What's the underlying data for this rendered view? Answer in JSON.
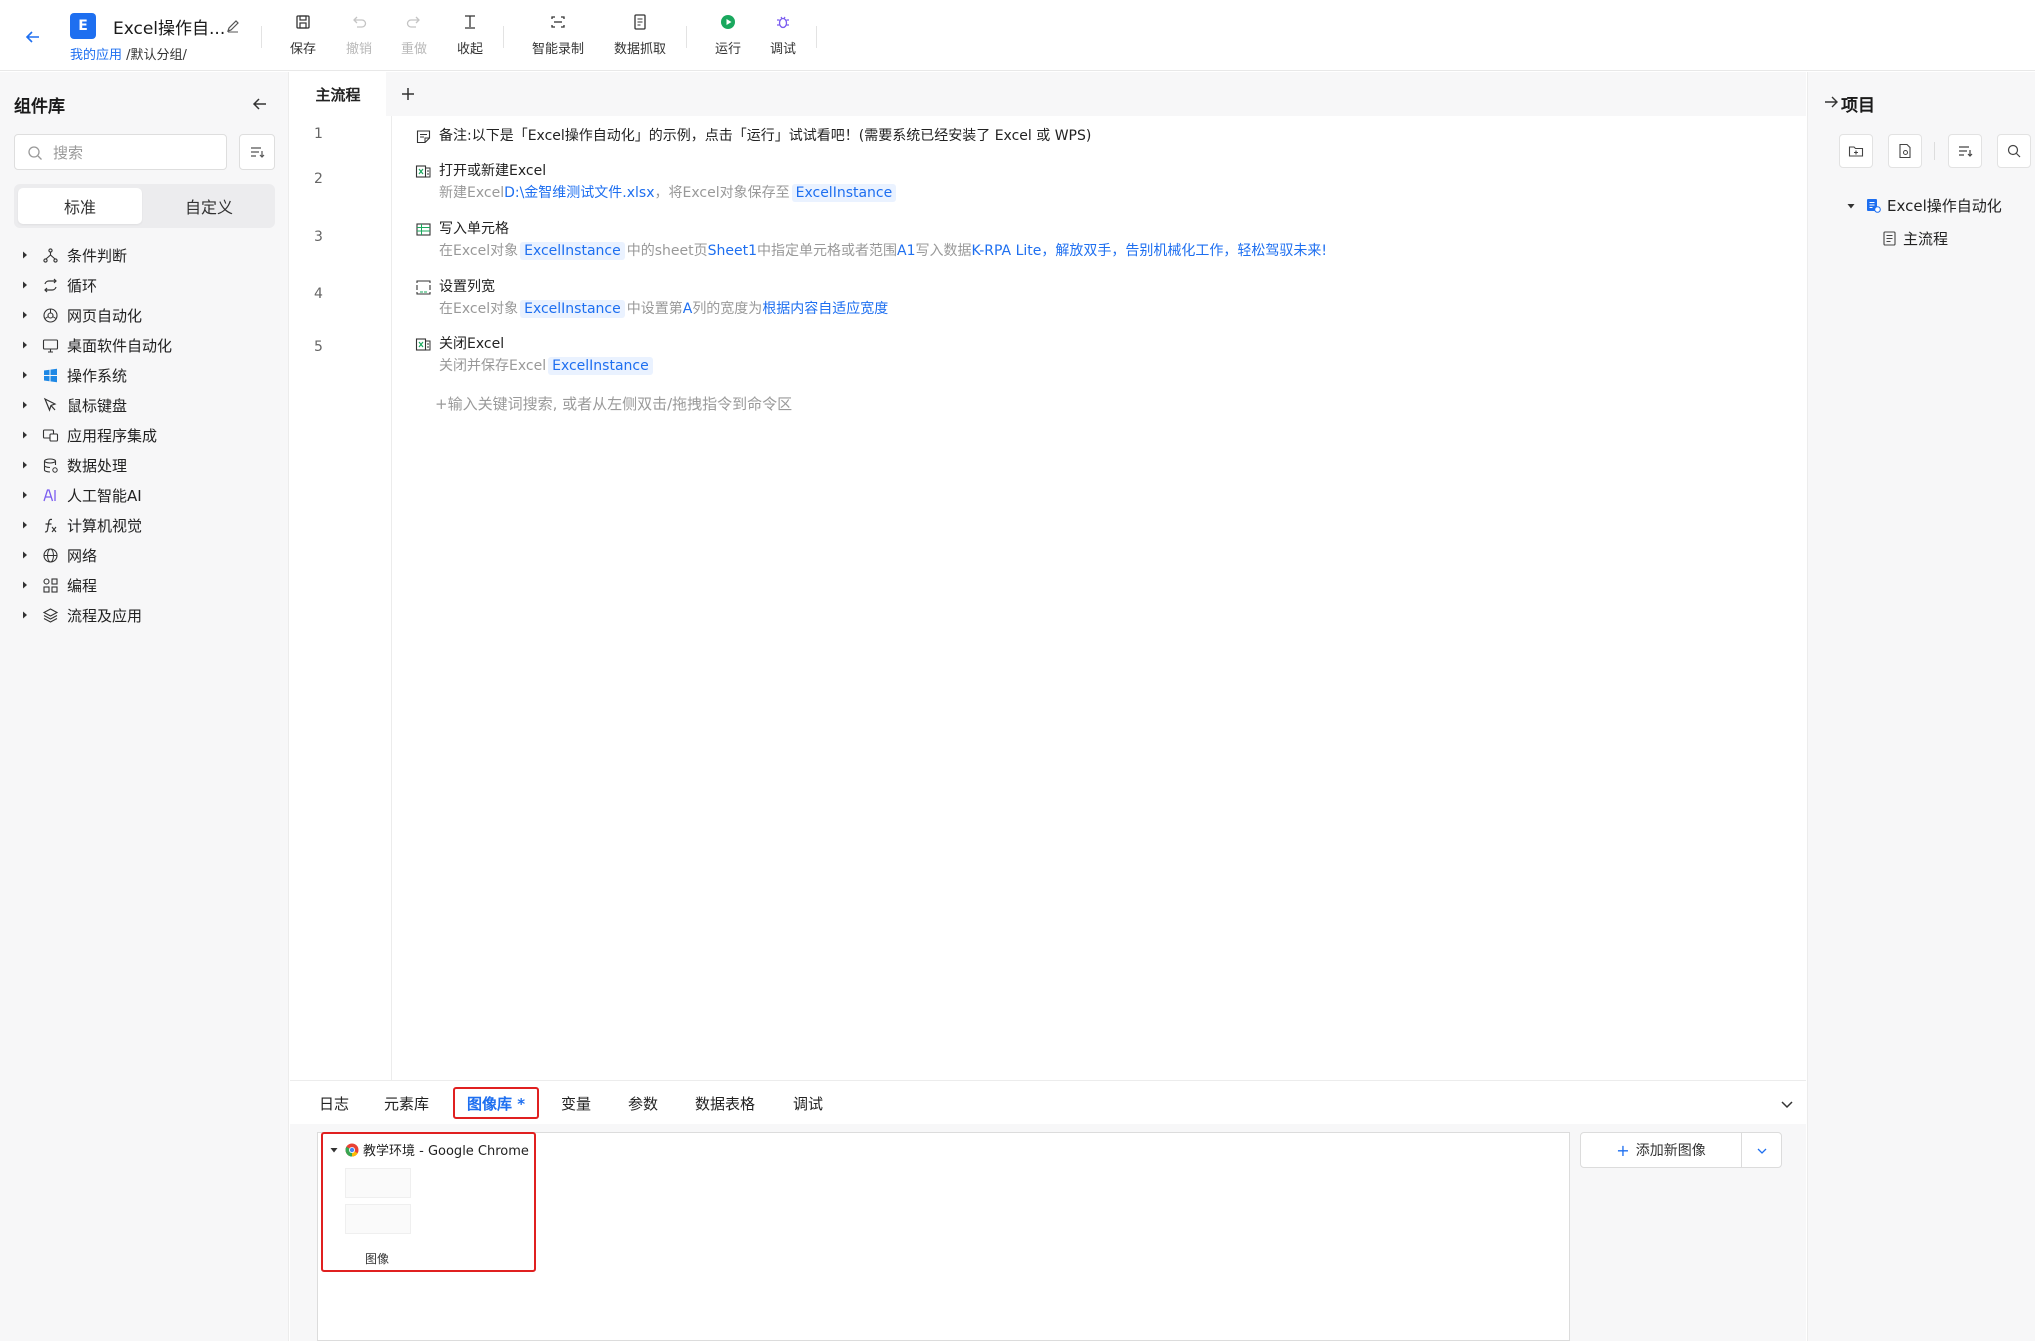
{
  "header": {
    "app_badge": "E",
    "app_title": "Excel操作自...",
    "breadcrumb_link": "我的应用",
    "breadcrumb_rest": "/默认分组/"
  },
  "toolbar": {
    "save": "保存",
    "undo": "撤销",
    "redo": "重做",
    "collapse": "收起",
    "smart_record": "智能录制",
    "data_capture": "数据抓取",
    "run": "运行",
    "debug": "调试"
  },
  "sidebar": {
    "title": "组件库",
    "search_placeholder": "搜索",
    "tab_standard": "标准",
    "tab_custom": "自定义",
    "categories": [
      {
        "label": "条件判断",
        "icon": "branch-icon"
      },
      {
        "label": "循环",
        "icon": "loop-icon"
      },
      {
        "label": "网页自动化",
        "icon": "browser-icon"
      },
      {
        "label": "桌面软件自动化",
        "icon": "desktop-icon"
      },
      {
        "label": "操作系统",
        "icon": "windows-icon"
      },
      {
        "label": "鼠标键盘",
        "icon": "cursor-icon"
      },
      {
        "label": "应用程序集成",
        "icon": "app-integration-icon"
      },
      {
        "label": "数据处理",
        "icon": "database-icon"
      },
      {
        "label": "人工智能AI",
        "icon": "ai-icon"
      },
      {
        "label": "计算机视觉",
        "icon": "function-icon"
      },
      {
        "label": "网络",
        "icon": "globe-icon"
      },
      {
        "label": "编程",
        "icon": "code-blocks-icon"
      },
      {
        "label": "流程及应用",
        "icon": "layers-icon"
      }
    ]
  },
  "editor": {
    "tab_main": "主流程",
    "line_numbers": [
      "1",
      "2",
      "3",
      "4",
      "5"
    ],
    "note": "备注:以下是「Excel操作自动化」的示例，点击「运行」试试看吧！(需要系统已经安装了 Excel 或 WPS)",
    "steps": {
      "s2": {
        "title": "打开或新建Excel",
        "d1": "新建Excel",
        "d2": "D:\\金智维测试文件.xlsx",
        "d3": "，将Excel对象保存至",
        "var": "ExcelInstance"
      },
      "s3": {
        "title": "写入单元格",
        "d1": "在Excel对象",
        "var": "ExcelInstance",
        "d2": "中的sheet页",
        "d3": "Sheet1",
        "d4": "中指定单元格或者范围",
        "d5": "A1",
        "d6": "写入数据",
        "d7": "K-RPA Lite，解放双手，告别机械化工作，轻松驾驭未来!"
      },
      "s4": {
        "title": "设置列宽",
        "d1": "在Excel对象",
        "var": "ExcelInstance",
        "d2": "中设置第",
        "d3": "A",
        "d4": "列的宽度为",
        "d5": "根据内容自适应宽度"
      },
      "s5": {
        "title": "关闭Excel",
        "d1": "关闭并保存Excel",
        "var": "ExcelInstance"
      }
    },
    "hint": "+输入关键词搜索, 或者从左侧双击/拖拽指令到命令区"
  },
  "right_panel": {
    "title": "项目",
    "tree_root": "Excel操作自动化",
    "tree_child": "主流程"
  },
  "bottom": {
    "tabs": [
      "日志",
      "元素库",
      "图像库 *",
      "变量",
      "参数",
      "数据表格",
      "调试"
    ],
    "chrome_node": "教学环境 - Google Chrome",
    "image_label": "图像",
    "add_image": "添加新图像"
  },
  "colors": {
    "accent": "#1e6ff0",
    "highlight_red": "#e02020",
    "note_green": "#1aa85e",
    "run_green": "#1aa85e",
    "debug_purple": "#7a5cf0"
  }
}
